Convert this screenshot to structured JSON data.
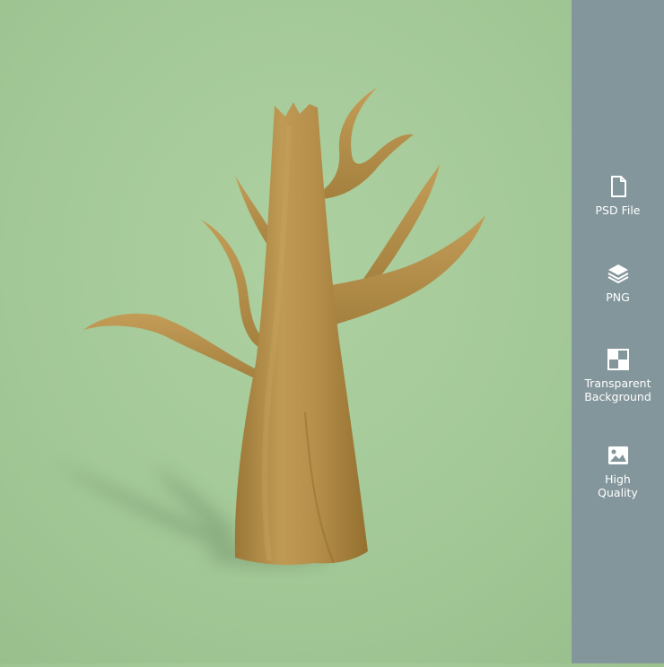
{
  "scene": {
    "subject_icon": "bare-tree-illustration",
    "background_color": "#a5c999",
    "tree_color": "#b8924e"
  },
  "sidebar": {
    "background_color": "#83969b",
    "features": [
      {
        "icon": "file-icon",
        "label_line1": "PSD File",
        "label_line2": ""
      },
      {
        "icon": "layers-icon",
        "label_line1": "PNG",
        "label_line2": ""
      },
      {
        "icon": "transparency-grid-icon",
        "label_line1": "Transparent",
        "label_line2": "Background"
      },
      {
        "icon": "image-icon",
        "label_line1": "High",
        "label_line2": "Quality"
      }
    ]
  }
}
